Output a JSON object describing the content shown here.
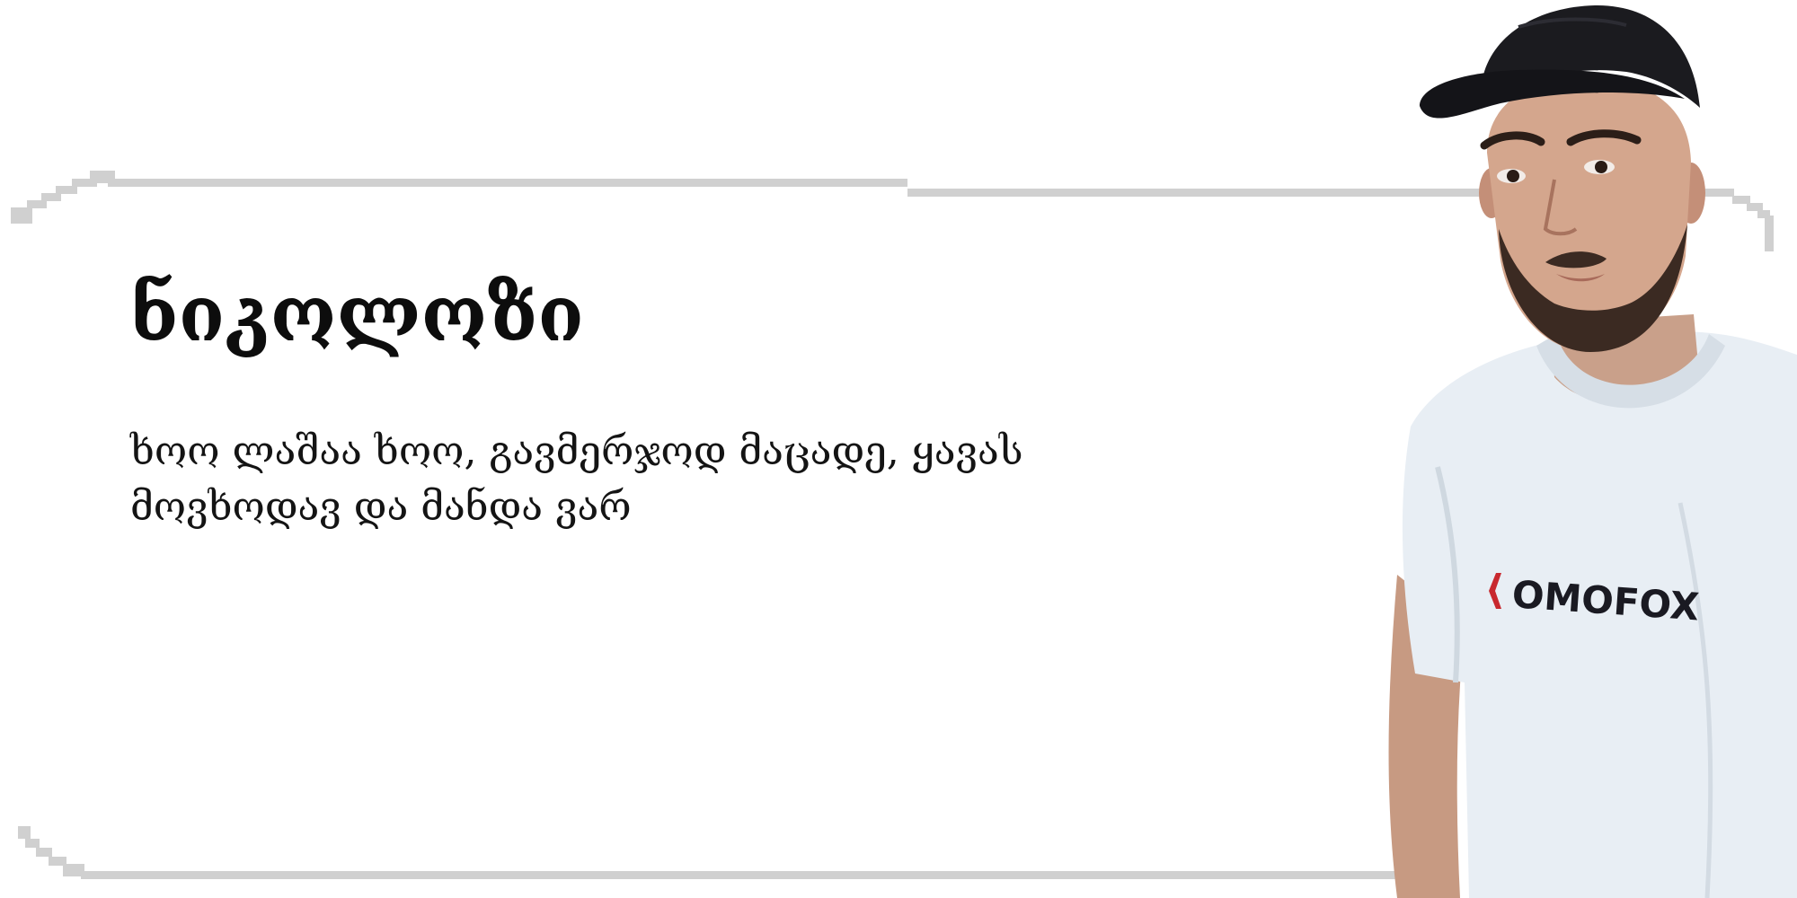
{
  "profile": {
    "name": "ნიკოლოზი",
    "bio_line_1": "ხოო ლაშაა ხოო, გავმერჯოდ მაცადე, ყავას",
    "bio_line_2": "მოვხოდავ და მანდა ვარ"
  },
  "photo": {
    "shirt_logo_text": "OMOFOX",
    "subject": "young man wearing a black cap and white t-shirt"
  },
  "colors": {
    "background": "#ffffff",
    "frame": "#d0d0d0",
    "text": "#111111",
    "shirt": "#e8eef4",
    "cap": "#1b1b1f",
    "logo_red": "#c8282e"
  }
}
